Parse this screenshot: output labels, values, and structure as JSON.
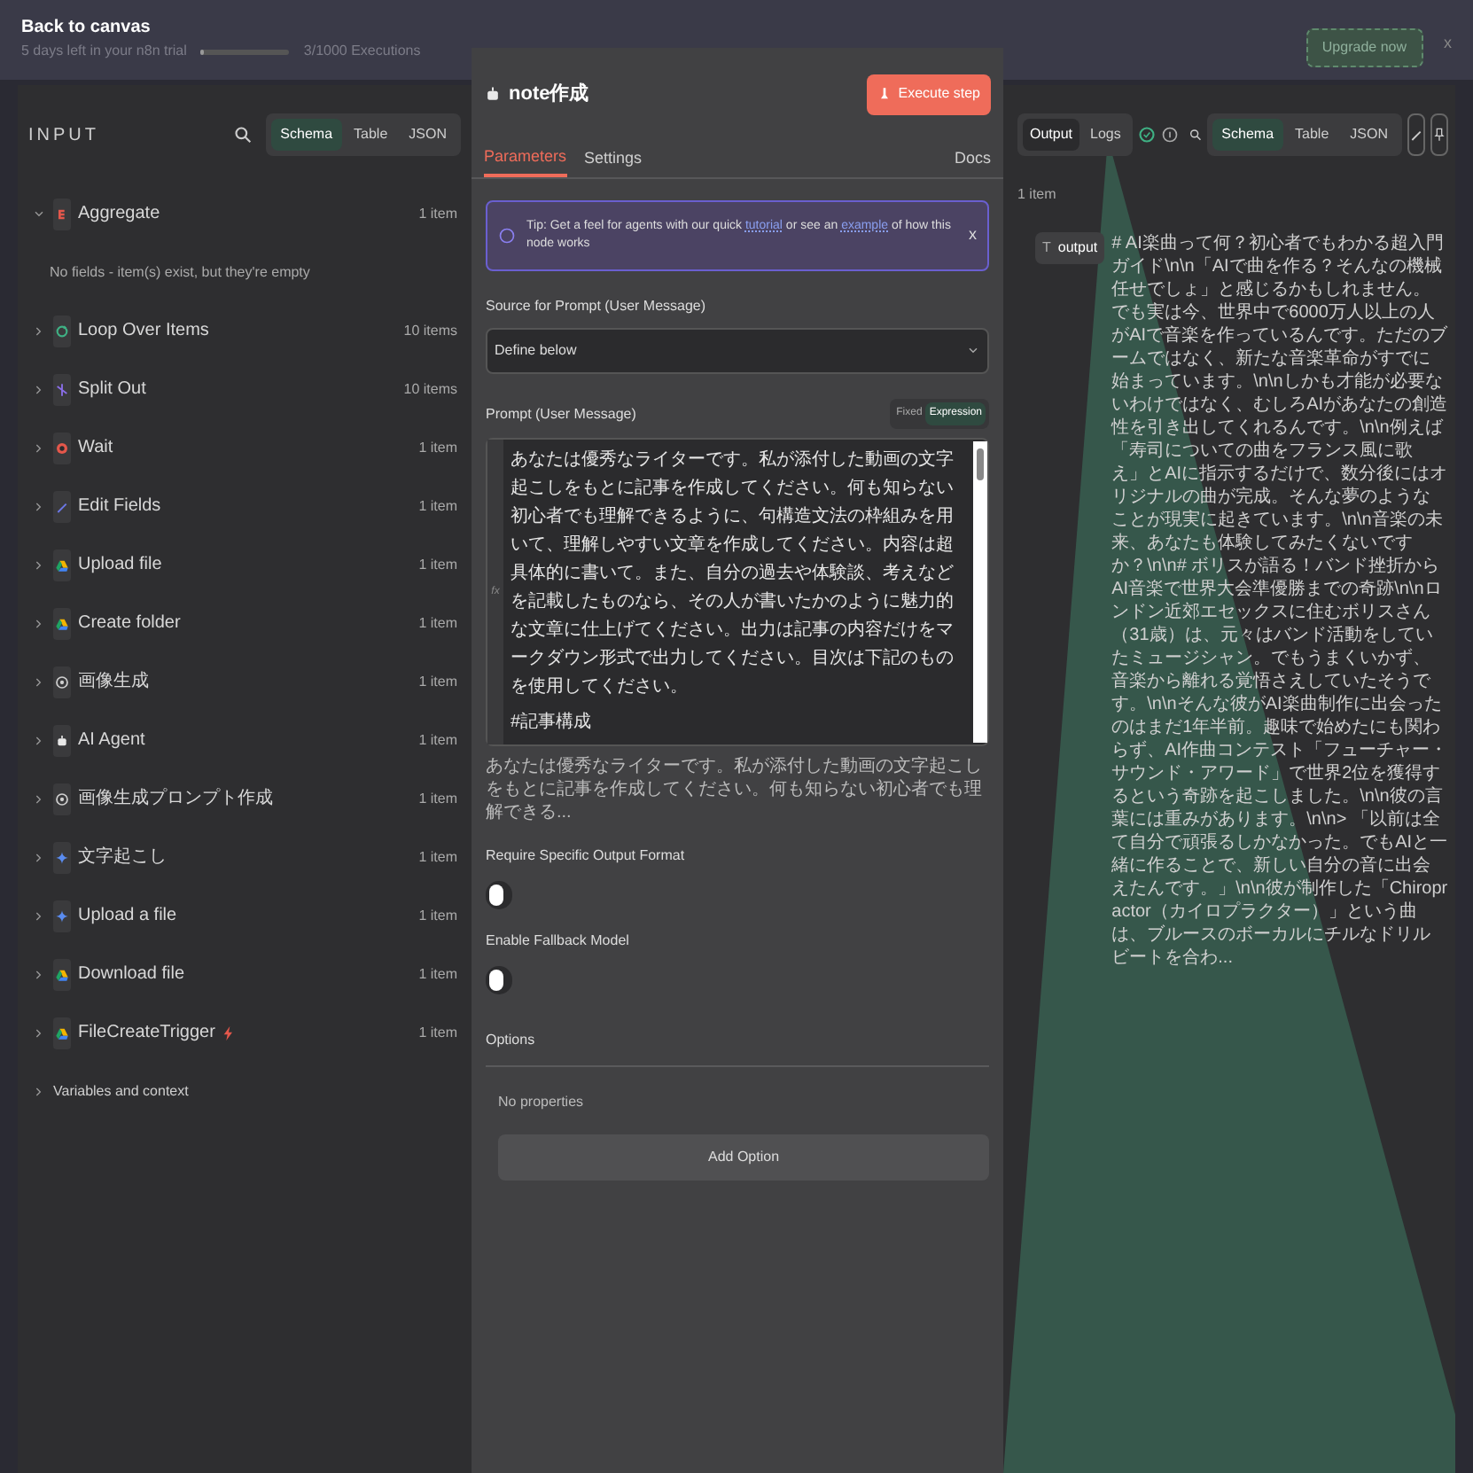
{
  "topbar": {
    "back": "Back to canvas",
    "trial": "5 days left in your n8n trial",
    "executions": "3/1000 Executions",
    "executions_bar": {
      "level": 0.03
    },
    "upgrade": "Upgrade now",
    "close": "x"
  },
  "input": {
    "title": "INPUT",
    "views": [
      {
        "label": "Schema",
        "selected": true
      },
      {
        "label": "Table",
        "selected": false
      },
      {
        "label": "JSON",
        "selected": false
      }
    ],
    "nodes": [
      {
        "name": "Aggregate",
        "kind": "aggregate",
        "count": "1 item",
        "expanded": true,
        "note": "No fields - item(s) exist, but they're empty"
      },
      {
        "name": "Loop Over Items",
        "kind": "loop",
        "count": "10 items",
        "expanded": false
      },
      {
        "name": "Split Out",
        "kind": "split",
        "count": "10 items",
        "expanded": false
      },
      {
        "name": "Wait",
        "kind": "wait",
        "count": "1 item",
        "expanded": false
      },
      {
        "name": "Edit Fields",
        "kind": "edit",
        "count": "1 item",
        "expanded": false
      },
      {
        "name": "Upload file",
        "kind": "drive",
        "count": "1 item",
        "expanded": false
      },
      {
        "name": "Create folder",
        "kind": "drive",
        "count": "1 item",
        "expanded": false
      },
      {
        "name": "画像生成",
        "kind": "openai",
        "count": "1 item",
        "expanded": false
      },
      {
        "name": "AI Agent",
        "kind": "agent",
        "count": "1 item",
        "expanded": false
      },
      {
        "name": "画像生成プロンプト作成",
        "kind": "openai",
        "count": "1 item",
        "expanded": false
      },
      {
        "name": "文字起こし",
        "kind": "gemini",
        "count": "1 item",
        "expanded": false
      },
      {
        "name": "Upload a file",
        "kind": "gemini",
        "count": "1 item",
        "expanded": false
      },
      {
        "name": "Download file",
        "kind": "drive",
        "count": "1 item",
        "expanded": false
      },
      {
        "name": "FileCreateTrigger",
        "kind": "drive",
        "count": "1 item",
        "expanded": false,
        "trigger": true
      }
    ],
    "variables": "Variables and context"
  },
  "node": {
    "title": "note作成",
    "execute": "Execute step",
    "tabs": [
      {
        "label": "Parameters",
        "selected": true
      },
      {
        "label": "Settings",
        "selected": false
      }
    ],
    "docs": "Docs",
    "tip": {
      "before": "Tip: Get a feel for agents with our quick ",
      "link1": "tutorial",
      "middle": " or see an ",
      "link2": "example",
      "after": " of how this node works",
      "close": "x"
    },
    "source_label": "Source for Prompt (User Message)",
    "source_value": "Define below",
    "prompt_label": "Prompt (User Message)",
    "modes": [
      {
        "label": "Fixed",
        "selected": false
      },
      {
        "label": "Expression",
        "selected": true
      }
    ],
    "fx": "fx",
    "prompt_lines": [
      "あなたは優秀なライターです。私が添付した動画の文字起こしをもとに記事を作成してください。何も知らない初心者でも理解できるように、句構造文法の枠組みを用いて、理解しやすい文章を作成してください。内容は超具体的に書いて。また、自分の過去や体験談、考えなどを記載したものなら、その人が書いたかのように魅力的な文章に仕上げてください。出力は記事の内容だけをマークダウン形式で出力してください。目次は下記のものを使用してください。",
      "#記事構成"
    ],
    "preview": "あなたは優秀なライターです。私が添付した動画の文字起こしをもとに記事を作成してください。何も知らない初心者でも理解できる...",
    "toggles": [
      {
        "label": "Require Specific Output Format",
        "on": false
      },
      {
        "label": "Enable Fallback Model",
        "on": false
      }
    ],
    "options_label": "Options",
    "no_properties": "No properties",
    "add_option": "Add Option"
  },
  "output": {
    "tabs": [
      {
        "label": "Output",
        "selected": true
      },
      {
        "label": "Logs",
        "selected": false
      }
    ],
    "views": [
      {
        "label": "Schema",
        "selected": true
      },
      {
        "label": "Table",
        "selected": false
      },
      {
        "label": "JSON",
        "selected": false
      }
    ],
    "count": "1 item",
    "field_type": "T",
    "field": "output",
    "value": "# AI楽曲って何？初心者でもわかる超入門ガイド\\n\\n「AIで曲を作る？そんなの機械任せでしょ」と感じるかもしれません。でも実は今、世界中で6000万人以上の人がAIで音楽を作っているんです。ただのブームではなく、新たな音楽革命がすでに始まっています。\\n\\nしかも才能が必要ないわけではなく、むしろAIがあなたの創造性を引き出してくれるんです。\\n\\n例えば「寿司についての曲をフランス風に歌え」とAIに指示するだけで、数分後にはオリジナルの曲が完成。そんな夢のようなことが現実に起きています。\\n\\n音楽の未来、あなたも体験してみたくないですか？\\n\\n# ボリスが語る！バンド挫折からAI音楽で世界大会準優勝までの奇跡\\n\\nロンドン近郊エセックスに住むボリスさん（31歳）は、元々はバンド活動をしていたミュージシャン。でもうまくいかず、音楽から離れる覚悟さえしていたそうです。\\n\\nそんな彼がAI楽曲制作に出会ったのはまだ1年半前。趣味で始めたにも関わらず、AI作曲コンテスト「フューチャー・サウンド・アワード」で世界2位を獲得するという奇跡を起こしました。\\n\\n彼の言葉には重みがあります。\\n\\n> 「以前は全て自分で頑張るしかなかった。でもAIと一緒に作ることで、新しい自分の音に出会えたんです。」\\n\\n彼が制作した「Chiropractor（カイロプラクター）」という曲は、ブルースのボーカルにチルなドリルビートを合わ..."
  }
}
